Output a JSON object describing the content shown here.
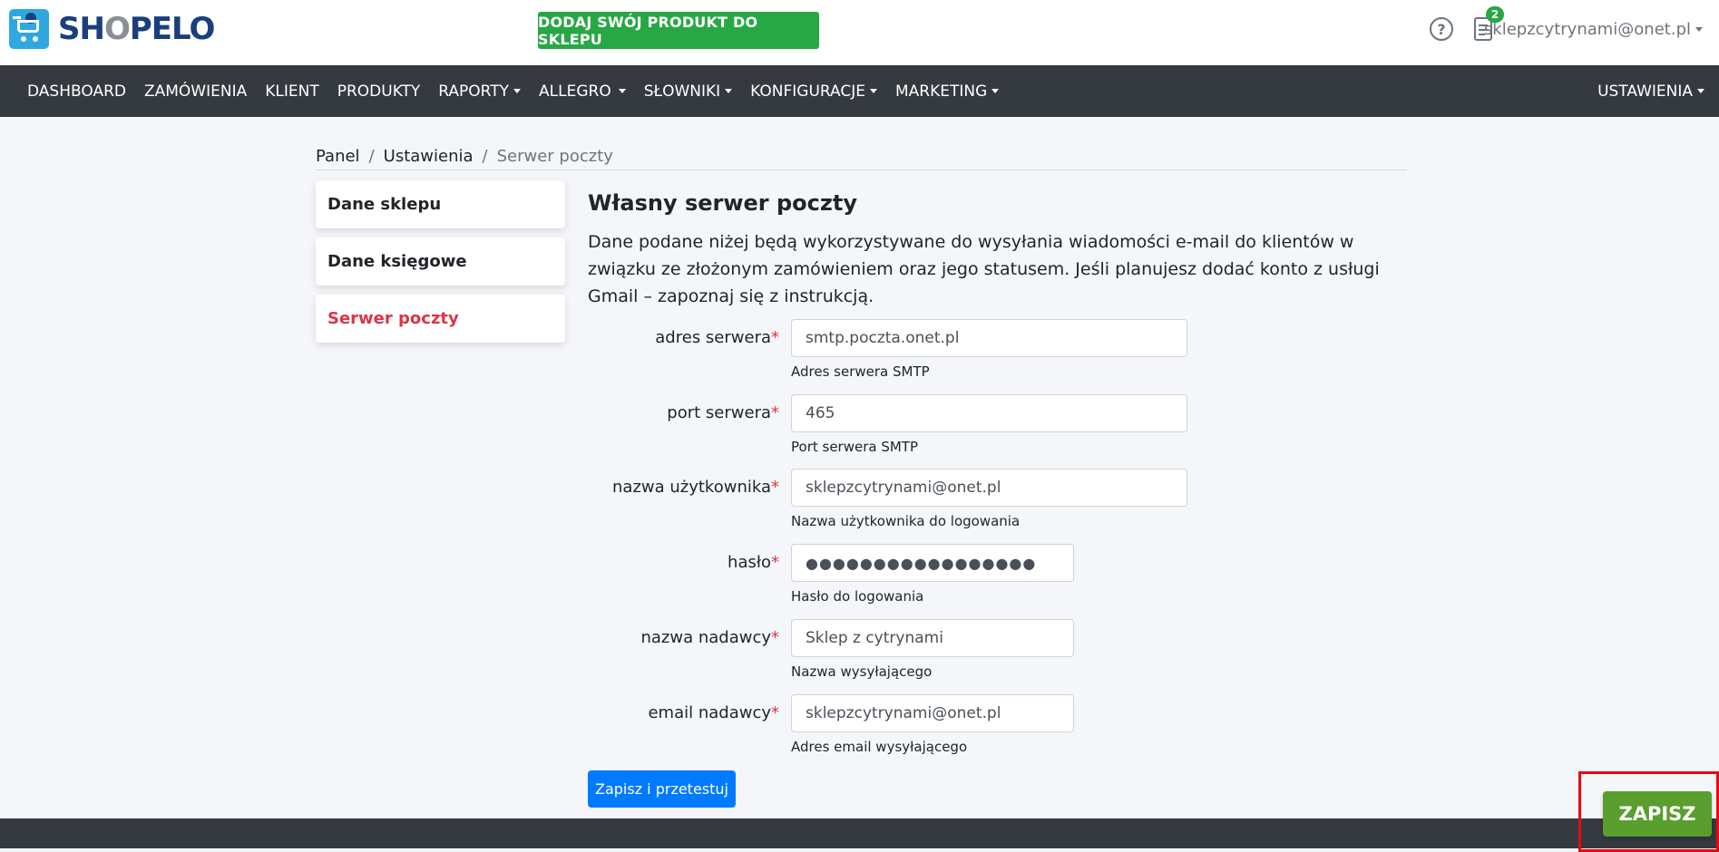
{
  "header": {
    "logo_prefix": "SH",
    "logo_o": "O",
    "logo_suffix": "PELO",
    "add_product_label": "DODAJ SWÓJ PRODUKT DO SKLEPU",
    "help_icon": "?",
    "notifications_count": "2",
    "user_email": "sklepzcytrynami@onet.pl"
  },
  "nav": {
    "items": [
      {
        "label": "DASHBOARD",
        "dropdown": false
      },
      {
        "label": "ZAMÓWIENIA",
        "dropdown": false
      },
      {
        "label": "KLIENT",
        "dropdown": false
      },
      {
        "label": "PRODUKTY",
        "dropdown": false
      },
      {
        "label": "RAPORTY",
        "dropdown": true
      },
      {
        "label": "ALLEGRO",
        "dropdown": true
      },
      {
        "label": "SŁOWNIKI",
        "dropdown": true
      },
      {
        "label": "KONFIGURACJE",
        "dropdown": true
      },
      {
        "label": "MARKETING",
        "dropdown": true
      }
    ],
    "settings_label": "USTAWIENIA"
  },
  "breadcrumb": {
    "items": [
      "Panel",
      "Ustawienia",
      "Serwer poczty"
    ],
    "separator": "/"
  },
  "sidebar": {
    "items": [
      {
        "label": "Dane sklepu"
      },
      {
        "label": "Dane księgowe"
      },
      {
        "label": "Serwer poczty"
      }
    ]
  },
  "main": {
    "title": "Własny serwer poczty",
    "description": "Dane podane niżej będą wykorzystywane do wysyłania wiadomości e-mail do klientów w związku ze złożonym zamówieniem oraz jego statusem. Jeśli planujesz dodać konto z usługi Gmail – zapoznaj się z instrukcją.",
    "required_mark": "*",
    "fields": {
      "server": {
        "label": "adres serwera",
        "value": "smtp.poczta.onet.pl",
        "help": "Adres serwera SMTP"
      },
      "port": {
        "label": "port serwera",
        "value": "465",
        "help": "Port serwera SMTP"
      },
      "username": {
        "label": "nazwa użytkownika",
        "value": "sklepzcytrynami@onet.pl",
        "help": "Nazwa użytkownika do logowania"
      },
      "password": {
        "label": "hasło",
        "value": "●●●●●●●●●●●●●●●●●",
        "help": "Hasło do logowania"
      },
      "sender_name": {
        "label": "nazwa nadawcy",
        "value": "Sklep z cytrynami",
        "help": "Nazwa wysyłającego"
      },
      "sender_email": {
        "label": "email nadawcy",
        "value": "sklepzcytrynami@onet.pl",
        "help": "Adres email wysyłającego"
      }
    },
    "test_button_label": "Zapisz i przetestuj"
  },
  "save_button_label": "ZAPISZ",
  "colors": {
    "nav_bg": "#343a40",
    "green": "#28a745",
    "primary": "#007bff",
    "danger": "#dc3545",
    "save_green": "#5a9e2e",
    "highlight_red": "#e50914"
  }
}
